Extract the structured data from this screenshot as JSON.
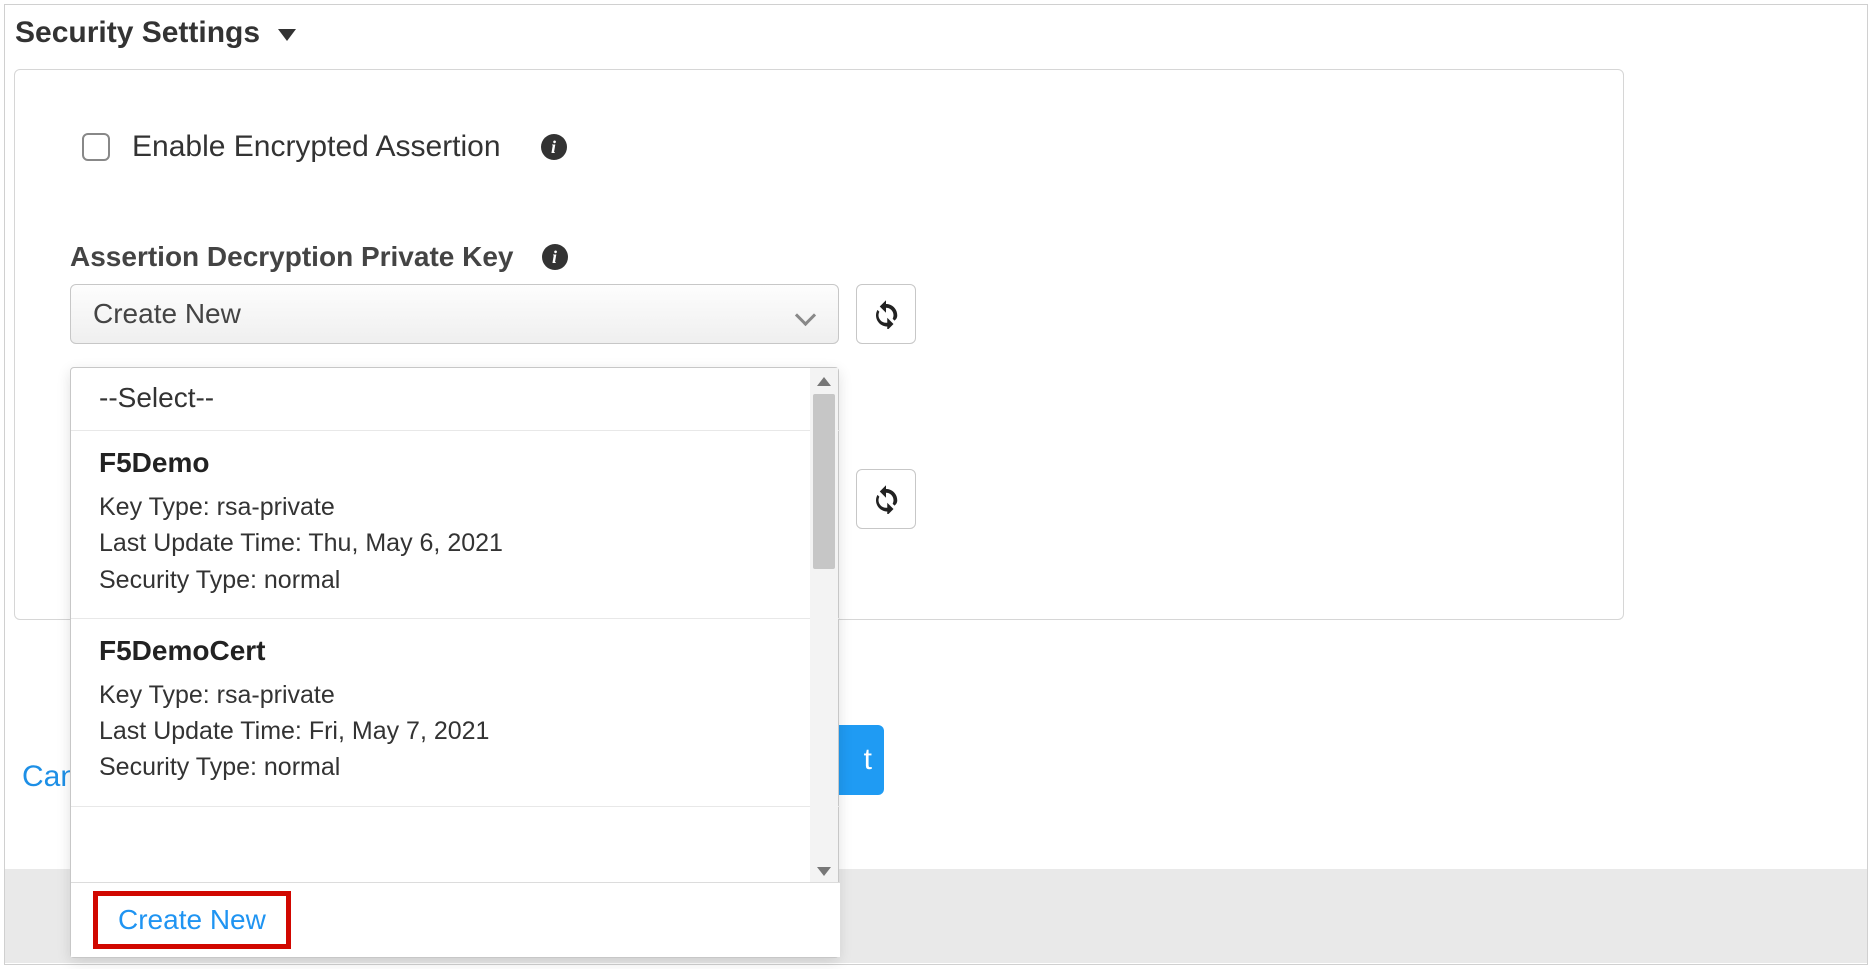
{
  "section": {
    "title": "Security Settings"
  },
  "checkbox": {
    "label": "Enable Encrypted Assertion"
  },
  "privateKey": {
    "label": "Assertion Decryption Private Key",
    "selected": "Create New"
  },
  "dropdown": {
    "placeholder": "--Select--",
    "options": [
      {
        "name": "F5Demo",
        "keyType": "Key Type: rsa-private",
        "lastUpdate": "Last Update Time: Thu, May 6, 2021",
        "securityType": "Security Type: normal"
      },
      {
        "name": "F5DemoCert",
        "keyType": "Key Type: rsa-private",
        "lastUpdate": "Last Update Time: Fri, May 7, 2021",
        "securityType": "Security Type: normal"
      }
    ],
    "createNew": "Create New"
  },
  "footer": {
    "cancel": "Can",
    "next": "t"
  }
}
